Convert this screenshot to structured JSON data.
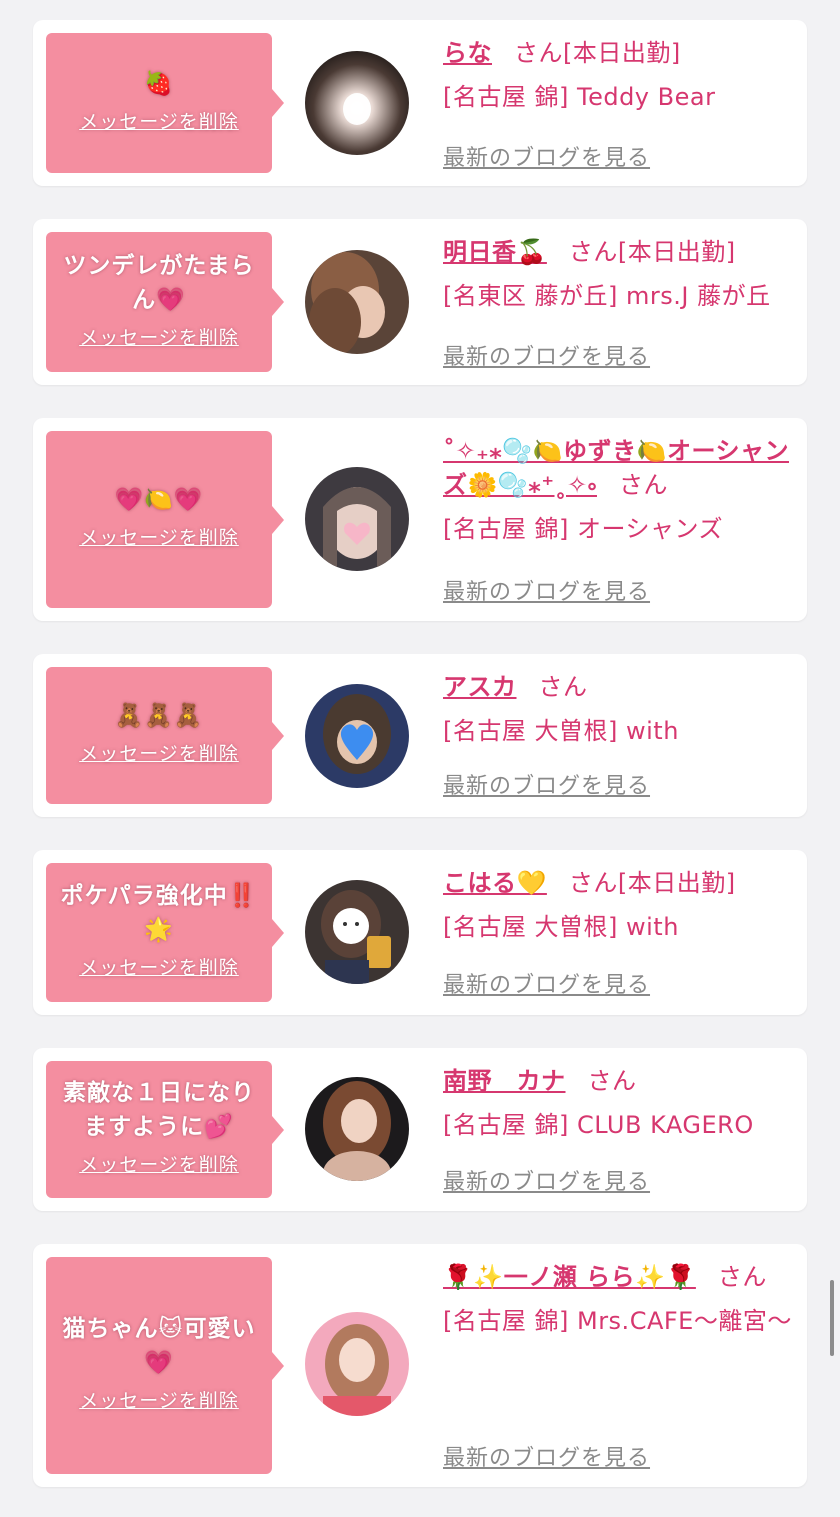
{
  "delete_label": "メッセージを削除",
  "blog_label": "最新のブログを見る",
  "san_label": "さん",
  "colors": {
    "accent": "#d6376f",
    "bubble": "#f48ea0",
    "background": "#f2f2f4"
  },
  "cards": [
    {
      "message": "🍓",
      "name": "らな",
      "status": "[本日出勤]",
      "shop": "[名古屋 錦] Teddy Bear"
    },
    {
      "message": "ツンデレがたまらん💗",
      "name": "明日香🍒",
      "status": "[本日出勤]",
      "shop": "[名東区 藤が丘] mrs.J 藤が丘"
    },
    {
      "message": "💗🍋💗",
      "name": "˚✧₊⁎🫧🍋ゆずき🍋オーシャンズ🌼🫧⁎⁺˳✧༚",
      "status": "",
      "shop": "[名古屋 錦] オーシャンズ"
    },
    {
      "message": "🧸🧸🧸",
      "name": "アスカ",
      "status": "",
      "shop": "[名古屋 大曽根] with"
    },
    {
      "message": "ポケパラ強化中‼️🌟",
      "name": "こはる💛",
      "status": "[本日出勤]",
      "shop": "[名古屋 大曽根] with"
    },
    {
      "message": "素敵な１日になりますように💕",
      "name": "南野　カナ",
      "status": "",
      "shop": "[名古屋 錦] CLUB KAGERO"
    },
    {
      "message": "猫ちゃん🐱可愛い💗",
      "name": "🌹✨一ノ瀬 らら✨🌹",
      "status": "",
      "shop": "[名古屋 錦] Mrs.CAFE〜離宮〜"
    }
  ]
}
